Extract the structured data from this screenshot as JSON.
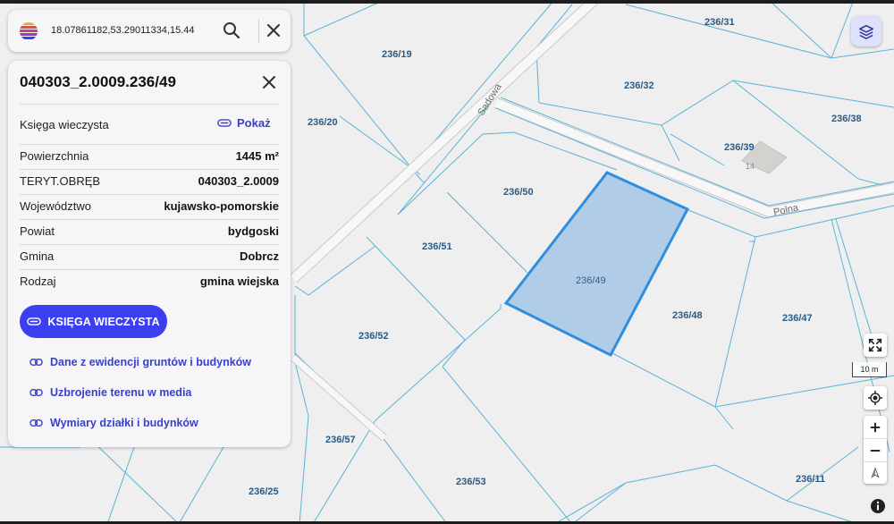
{
  "search": {
    "query": "18.07861182,53.29011334,15.44",
    "search_icon": "search-icon",
    "clear_icon": "close-icon"
  },
  "panel": {
    "title": "040303_2.0009.236/49",
    "land_register_label": "Księga wieczysta",
    "show_label": "Pokaż",
    "rows": [
      {
        "key": "Powierzchnia",
        "value": "1445 m²"
      },
      {
        "key": "TERYT.OBRĘB",
        "value": "040303_2.0009"
      },
      {
        "key": "Województwo",
        "value": "kujawsko-pomorskie"
      },
      {
        "key": "Powiat",
        "value": "bydgoski"
      },
      {
        "key": "Gmina",
        "value": "Dobrcz"
      },
      {
        "key": "Rodzaj",
        "value": "gmina wiejska"
      }
    ],
    "button_label": "KSIĘGA WIECZYSTA",
    "links": [
      "Dane z ewidencji gruntów i budynków",
      "Uzbrojenie terenu w media",
      "Wymiary działki i budynków"
    ]
  },
  "map": {
    "selected_parcel": "236/49",
    "parcels": [
      "236/31",
      "236/19",
      "236/32",
      "236/20",
      "236/38",
      "236/39",
      "236/50",
      "236/51",
      "236/49",
      "236/48",
      "236/47",
      "236/52",
      "236/57",
      "236/53",
      "236/25",
      "236/11"
    ],
    "streets": [
      "Sadowa",
      "Polna"
    ],
    "house_number": "14",
    "scale_label": "10 m",
    "colors": {
      "parcel_line": "#5bb3d6",
      "selected_fill": "#a9c8e6",
      "selected_stroke": "#2e8ee0",
      "accent": "#3b3fef"
    }
  },
  "controls": {
    "layers_icon": "layers-icon",
    "fullscreen_icon": "fullscreen-icon",
    "locate_icon": "locate-icon",
    "zoom_in_icon": "zoom-in-icon",
    "zoom_out_icon": "zoom-out-icon",
    "north_icon": "north-arrow-icon",
    "info_icon": "info-icon"
  }
}
